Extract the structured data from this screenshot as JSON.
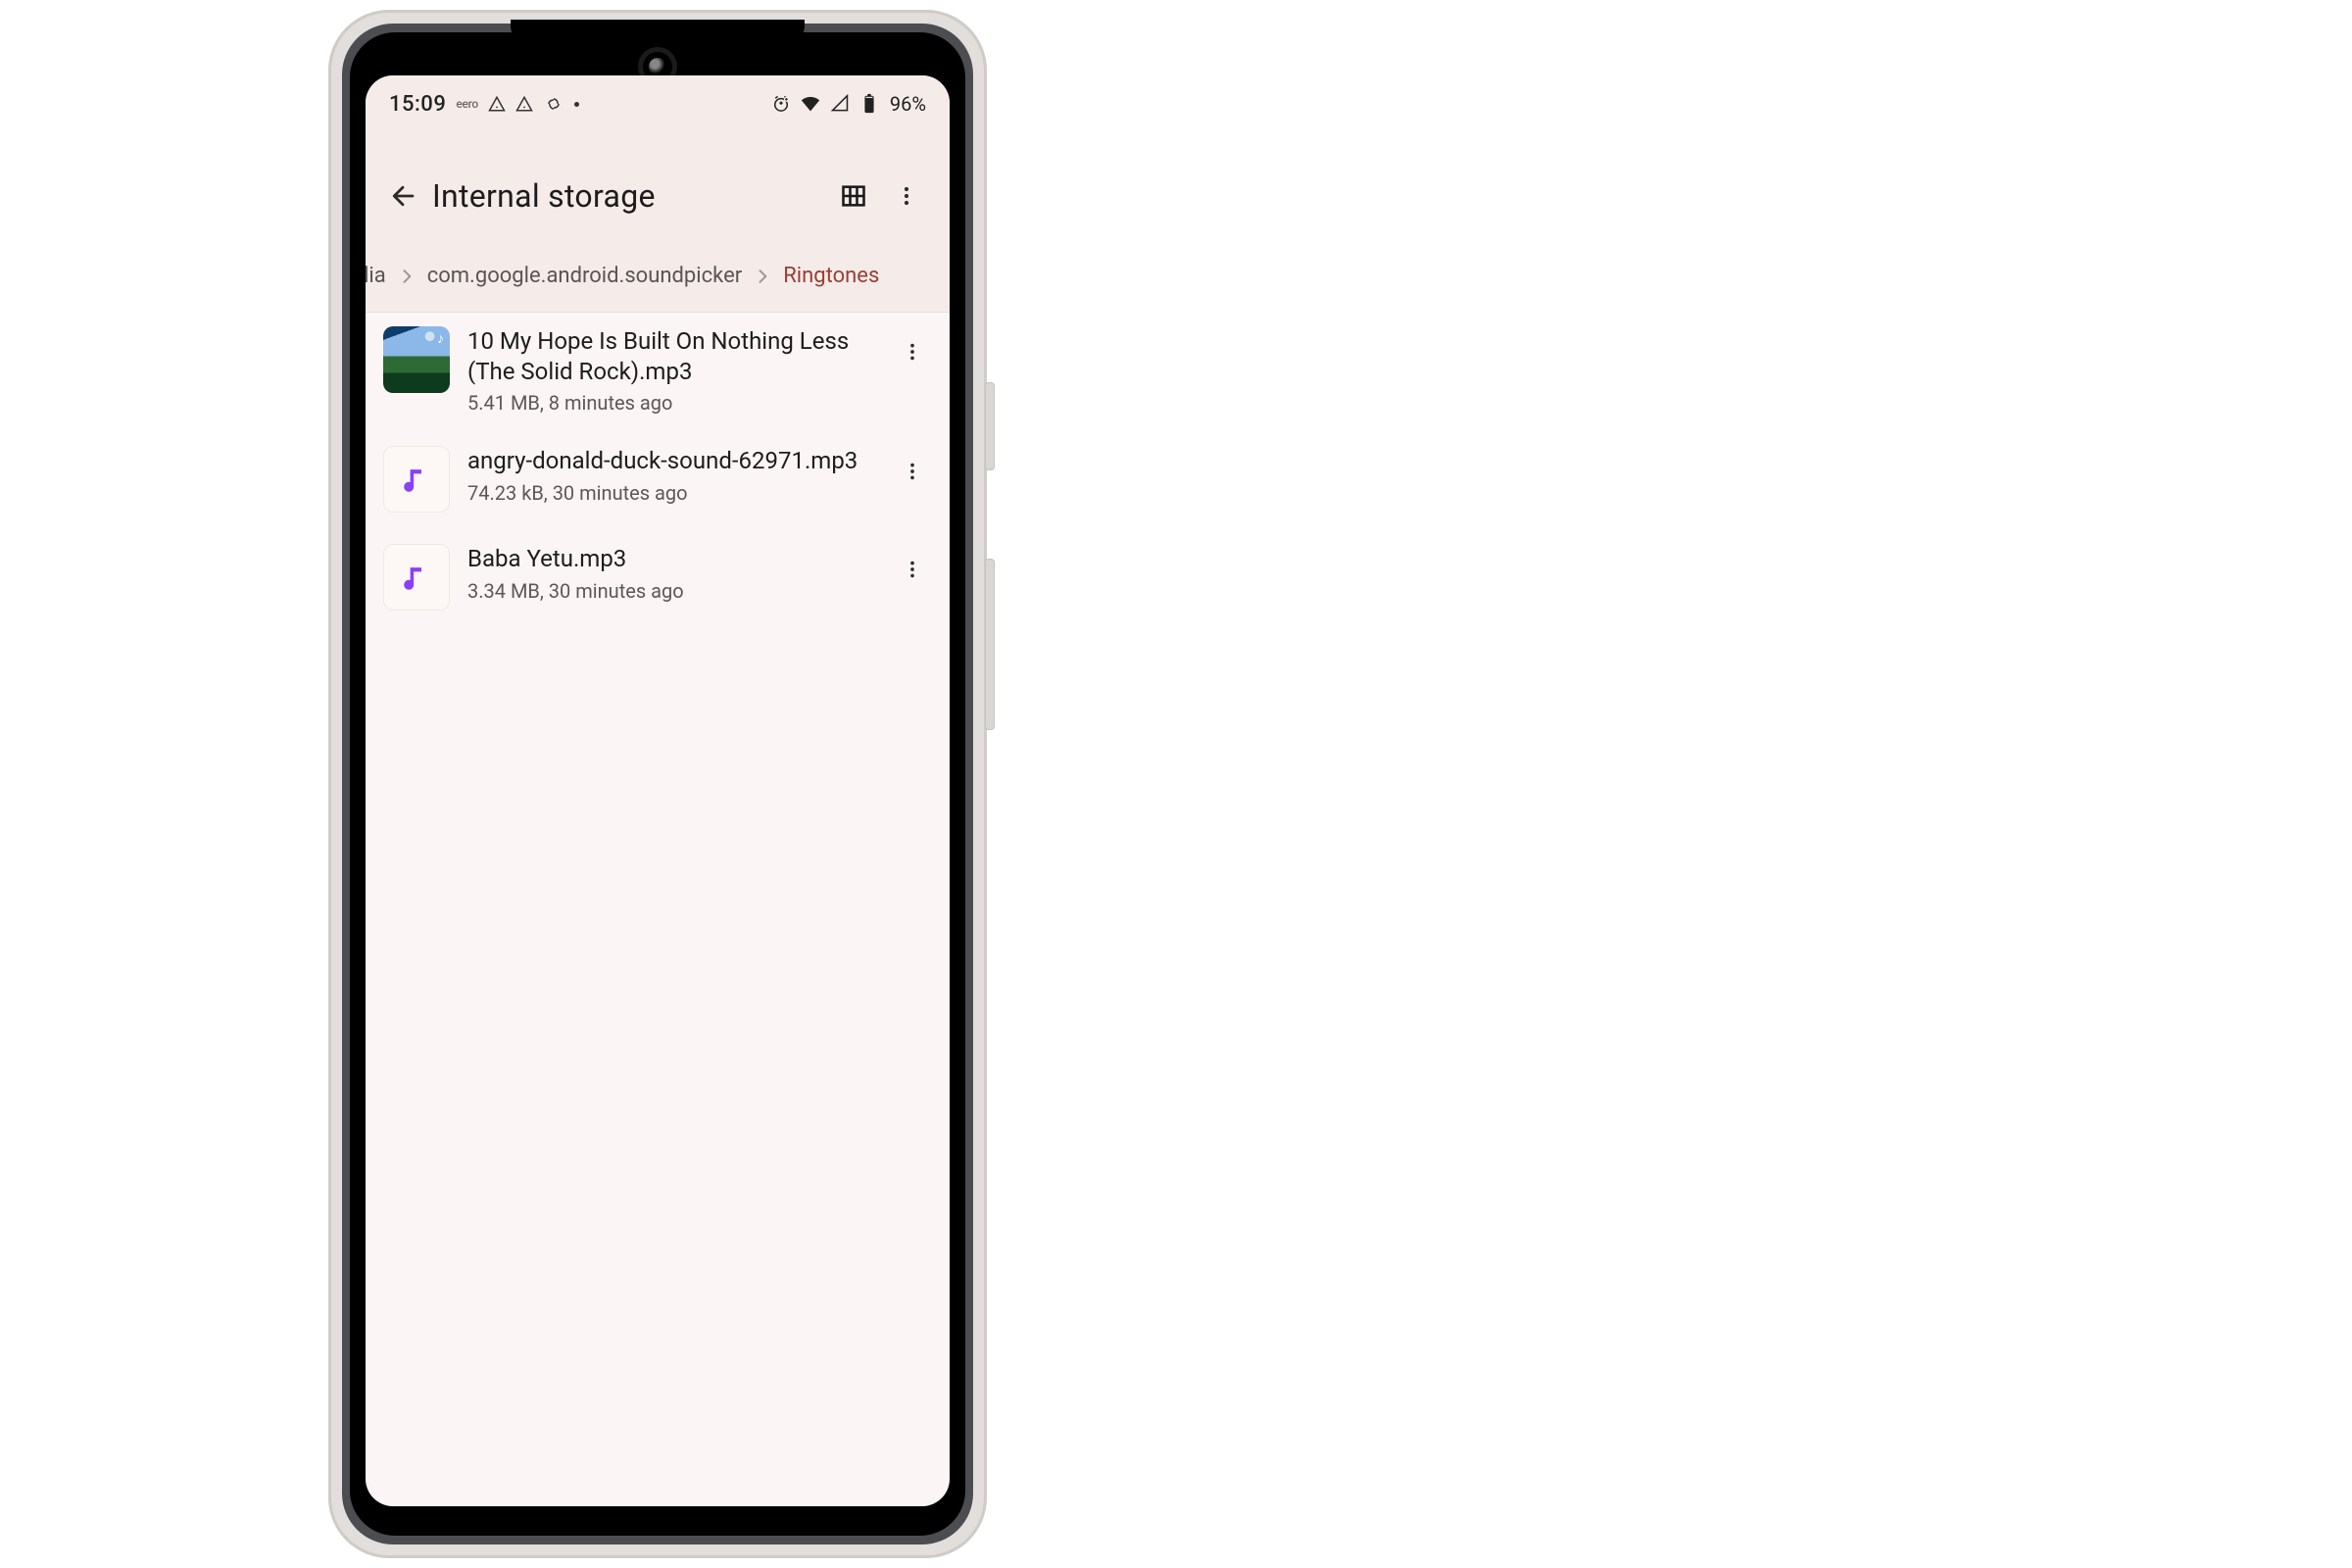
{
  "status": {
    "time": "15:09",
    "carrier": "eero",
    "battery_pct": "96%"
  },
  "appbar": {
    "title": "Internal storage"
  },
  "breadcrumb": {
    "segments": [
      "media",
      "com.google.android.soundpicker",
      "Ringtones"
    ]
  },
  "files": [
    {
      "name": "10 My Hope Is Built On Nothing Less (The Solid Rock).mp3",
      "meta": "5.41 MB, 8 minutes ago",
      "thumb": "album"
    },
    {
      "name": "angry-donald-duck-sound-62971.mp3",
      "meta": "74.23 kB, 30 minutes ago",
      "thumb": "audio"
    },
    {
      "name": "Baba Yetu.mp3",
      "meta": "3.34 MB, 30 minutes ago",
      "thumb": "audio"
    }
  ]
}
